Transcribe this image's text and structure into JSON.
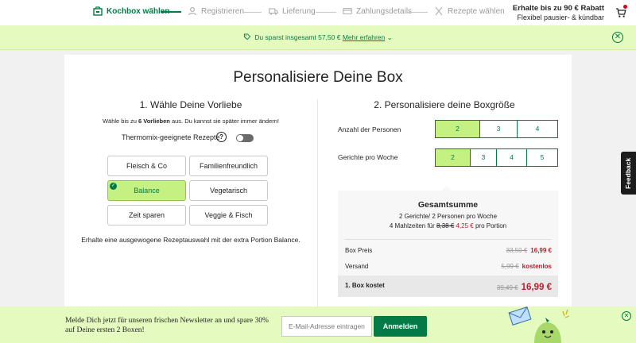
{
  "nav": {
    "steps": [
      {
        "label": "Kochbox wählen",
        "icon": "box-icon",
        "active": true
      },
      {
        "label": "Registrieren",
        "icon": "user-icon",
        "active": false
      },
      {
        "label": "Lieferung",
        "icon": "truck-icon",
        "active": false
      },
      {
        "label": "Zahlungsdetails",
        "icon": "card-icon",
        "active": false
      },
      {
        "label": "Rezepte wählen",
        "icon": "utensils-icon",
        "active": false
      }
    ],
    "promo_line1": "Erhalte bis zu 90 € Rabatt",
    "promo_line2": "Flexibel pausier- & kündbar",
    "cart_icon": "cart-icon"
  },
  "banner": {
    "text": "Du sparst insgesamt 57,50 €",
    "link": "Mehr erfahren",
    "icon": "tag-icon"
  },
  "page": {
    "title": "Personalisiere Deine Box"
  },
  "left": {
    "title": "1. Wähle Deine Vorliebe",
    "hint_pre": "Wähle bis zu ",
    "hint_bold": "6 Vorlieben",
    "hint_post": " aus. Du kannst sie später immer ändern!",
    "thermomix_label": "Thermomix-geeignete Rezepte",
    "thermomix_help": "?",
    "preferences": [
      {
        "label": "Fleisch & Co",
        "selected": false
      },
      {
        "label": "Familienfreundlich",
        "selected": false
      },
      {
        "label": "Balance",
        "selected": true
      },
      {
        "label": "Vegetarisch",
        "selected": false
      },
      {
        "label": "Zeit sparen",
        "selected": false
      },
      {
        "label": "Veggie & Fisch",
        "selected": false
      }
    ],
    "selected_description": "Erhalte eine ausgewogene Rezeptauswahl mit der extra Portion Balance."
  },
  "right": {
    "title": "2. Personalisiere deine Boxgröße",
    "persons_label": "Anzahl der Personen",
    "persons_options": [
      "2",
      "3",
      "4"
    ],
    "persons_selected": "2",
    "meals_label": "Gerichte pro Woche",
    "meals_options": [
      "2",
      "3",
      "4",
      "5"
    ],
    "meals_selected": "2",
    "summary": {
      "title": "Gesamtsumme",
      "line1": "2 Gerichte/ 2 Personen pro Woche",
      "line2_pre": "4 Mahlzeiten für ",
      "line2_old": "8,38 €",
      "line2_new": "4,25 €",
      "line2_post": " pro Portion",
      "box_price_label": "Box Preis",
      "box_price_old": "33,50 €",
      "box_price_new": "16,99 €",
      "shipping_label": "Versand",
      "shipping_old": "5,99 €",
      "shipping_new": "kostenlos",
      "total_label": "1. Box kostet",
      "total_old": "39,49 €",
      "total_new": "16,99 €"
    }
  },
  "feedback": {
    "label": "Feedback"
  },
  "newsletter": {
    "message": "Melde Dich jetzt für unseren frischen Newsletter an und spare 30% auf Deine ersten 2 Boxen!",
    "email_placeholder": "E-Mail-Adresse eintragen",
    "button": "Anmelden"
  },
  "colors": {
    "brand_green": "#067a46",
    "light_green": "#c5f082",
    "banner_bg": "#e4fabf",
    "price_red": "#b81e31"
  }
}
